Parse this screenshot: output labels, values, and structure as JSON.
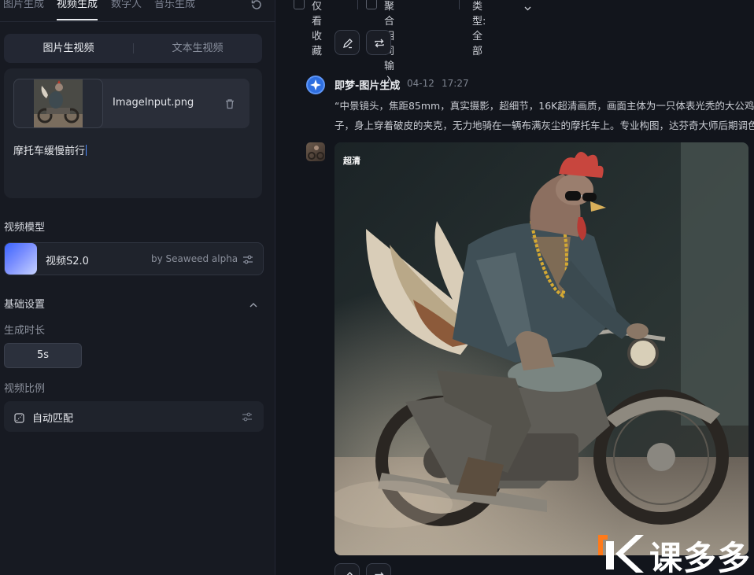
{
  "left_panel": {
    "tabs": [
      {
        "label": "图片生成",
        "active": false
      },
      {
        "label": "视频生成",
        "active": true
      },
      {
        "label": "数字人",
        "active": false
      },
      {
        "label": "音乐生成",
        "active": false
      }
    ],
    "mode_switch": {
      "image_to_video": "图片生视频",
      "text_to_video": "文本生视频",
      "selected": "图片生视频"
    },
    "upload": {
      "filename": "ImageInput.png",
      "prompt": "摩托车缓慢前行"
    },
    "model_section": {
      "title": "视频模型",
      "model_name": "视频S2.0",
      "model_by": "by Seaweed alpha"
    },
    "basic_settings": {
      "title": "基础设置",
      "duration_label": "生成时长",
      "duration_value": "5s",
      "ratio_label": "视频比例",
      "ratio_value": "自动匹配"
    }
  },
  "right_panel": {
    "filters": {
      "favorites_only": "仅看收藏",
      "merge_same_input": "聚合相同输入",
      "type_label": "类型: 全部"
    },
    "message": {
      "author": "即梦-图片生成",
      "date": "04-12",
      "time": "17:27",
      "description_line1": "“中景镜头，焦距85mm，真实摄影，超细节，16K超清画质，画面主体为一只体表光秃的大公鸡，戴着墨镜和金链",
      "description_line2": "子，身上穿着破皮的夹克，无力地骑在一辆布满灰尘的摩托车上。专业构图，达芬奇大师后期调色",
      "image_badge": "超清"
    },
    "watermark": "课多多"
  },
  "colors": {
    "accent_blue": "#2f6fe0",
    "panel_bg": "#171a22",
    "main_bg": "#12151c",
    "watermark_orange": "#ff7a1a"
  }
}
